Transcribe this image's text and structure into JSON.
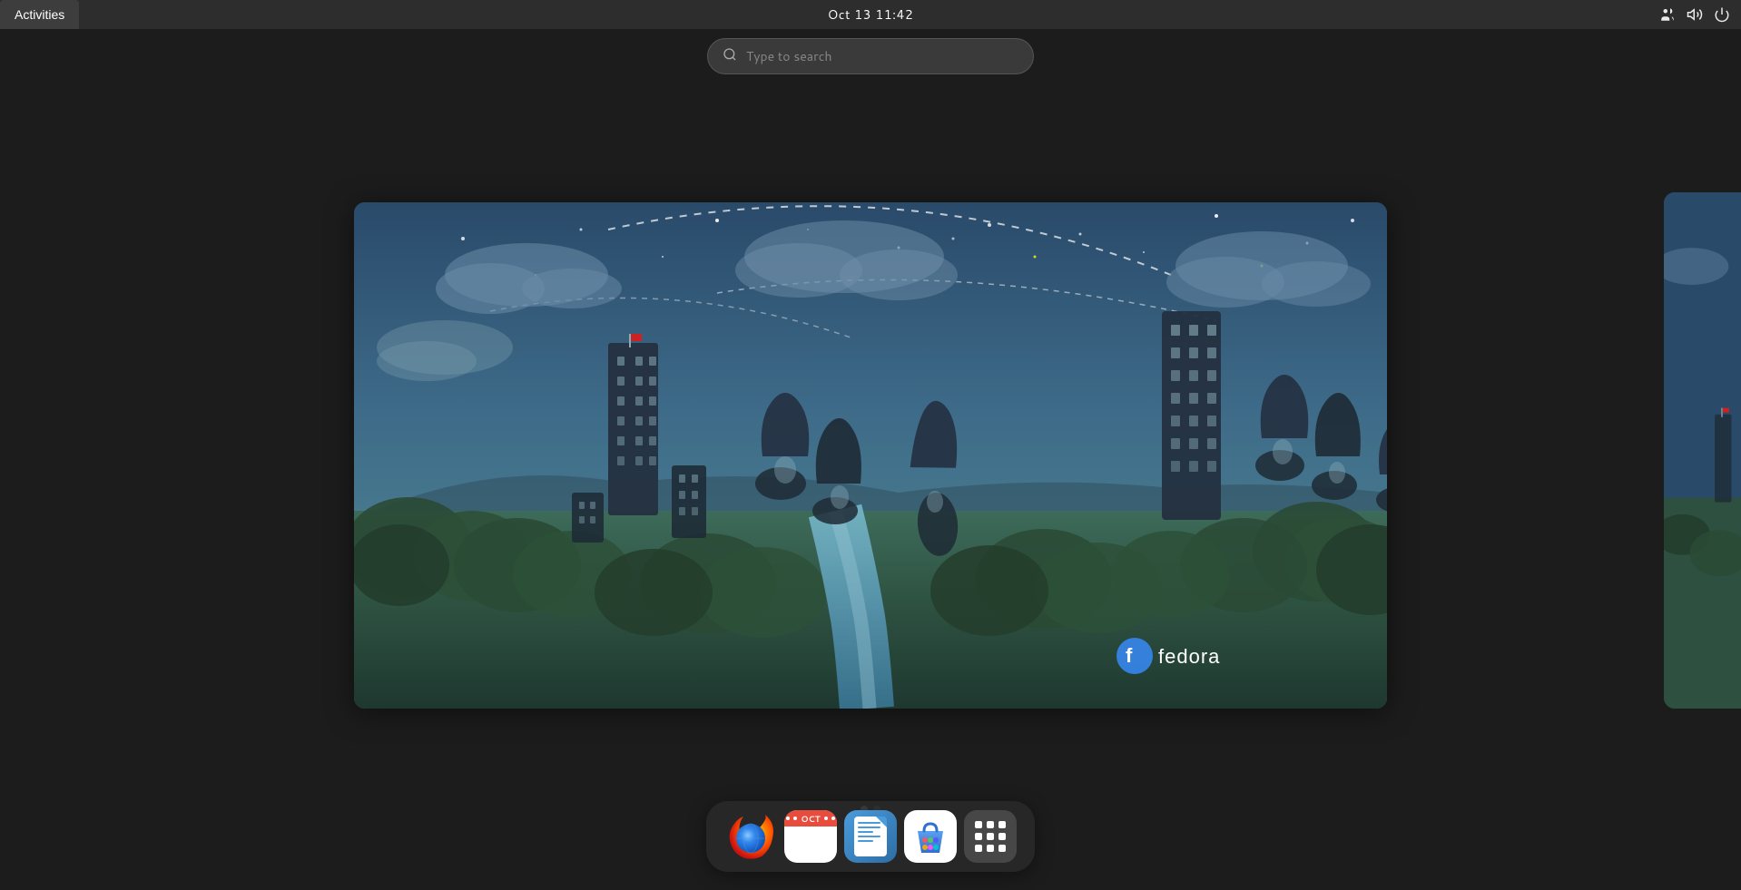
{
  "topbar": {
    "activities_label": "Activities",
    "datetime": "Oct 13  11:42",
    "icons": {
      "users_icon": "users-icon",
      "volume_icon": "volume-icon",
      "power_icon": "power-icon"
    }
  },
  "search": {
    "placeholder": "Type to search"
  },
  "workspaces": [
    {
      "id": "main",
      "active": true
    },
    {
      "id": "side",
      "active": false
    }
  ],
  "dock": {
    "apps": [
      {
        "name": "Firefox",
        "icon_type": "firefox"
      },
      {
        "name": "GNOME Calendar",
        "icon_type": "calendar"
      },
      {
        "name": "Writer",
        "icon_type": "writer"
      },
      {
        "name": "Software",
        "icon_type": "store"
      },
      {
        "name": "App Grid",
        "icon_type": "apps"
      }
    ]
  },
  "wallpaper": {
    "logo_text": "fedora",
    "brand": "fedora"
  },
  "colors": {
    "topbar_bg": "#2d2d2d",
    "activities_bg": "#3d3d3d",
    "search_bg": "#3a3a3a",
    "dock_bg": "rgba(40,40,40,0.92)",
    "accent": "#3584e4"
  }
}
